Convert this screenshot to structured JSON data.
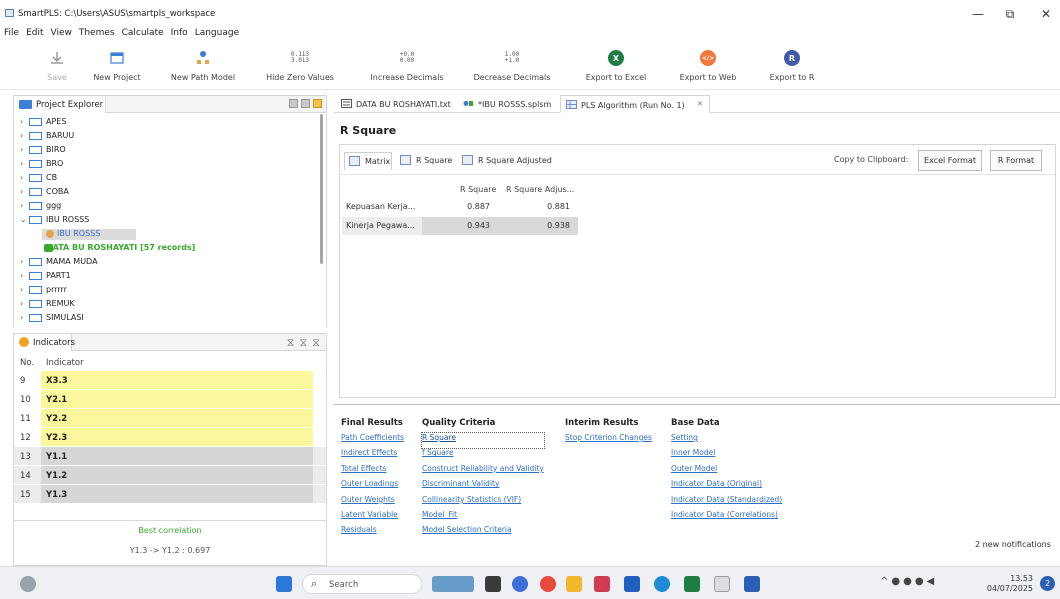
{
  "window": {
    "title": "SmartPLS: C:\\Users\\ASUS\\smartpls_workspace",
    "minimize": "—",
    "restore": "⧉",
    "close": "✕"
  },
  "menu": [
    "File",
    "Edit",
    "View",
    "Themes",
    "Calculate",
    "Info",
    "Language"
  ],
  "toolbar": {
    "save": "Save",
    "new_project": "New Project",
    "new_path_model": "New Path Model",
    "hide_zero_values": "Hide Zero Values",
    "hide_zero_icon": "0.113\n3.013",
    "increase_decimals": "Increase Decimals",
    "increase_icon": "+0.0\n0.00",
    "decrease_decimals": "Decrease Decimals",
    "decrease_icon": "1.00\n+1.0",
    "export_excel": "Export to Excel",
    "export_web": "Export to Web",
    "export_r": "Export to R",
    "excel_glyph": "X",
    "web_glyph": "</>",
    "r_glyph": "R"
  },
  "project_explorer": {
    "title": "Project Explorer",
    "items": [
      {
        "label": "APES"
      },
      {
        "label": "BARUU"
      },
      {
        "label": "BIRO"
      },
      {
        "label": "BRO"
      },
      {
        "label": "CB"
      },
      {
        "label": "COBA"
      },
      {
        "label": "ggg"
      },
      {
        "label": "IBU ROSSS"
      },
      {
        "label": "IBU ROSSS"
      },
      {
        "label": "DATA BU ROSHAYATI [57 records]"
      },
      {
        "label": "MAMA MUDA"
      },
      {
        "label": "PART1"
      },
      {
        "label": "prrrrr"
      },
      {
        "label": "REMUK"
      },
      {
        "label": "SIMULASI"
      }
    ]
  },
  "indicators": {
    "title": "Indicators",
    "col_no": "No.",
    "col_indicator": "Indicator",
    "rows": [
      {
        "no": "9",
        "name": "X3.3"
      },
      {
        "no": "10",
        "name": "Y2.1"
      },
      {
        "no": "11",
        "name": "Y2.2"
      },
      {
        "no": "12",
        "name": "Y2.3"
      },
      {
        "no": "13",
        "name": "Y1.1"
      },
      {
        "no": "14",
        "name": "Y1.2"
      },
      {
        "no": "15",
        "name": "Y1.3"
      }
    ],
    "best_correlation_label": "Best correlation",
    "best_correlation_value": "Y1.3 -> Y1.2 : 0.697"
  },
  "editor_tabs": [
    {
      "label": "DATA BU ROSHAYATI.txt"
    },
    {
      "label": "*IBU ROSSS.splsm"
    },
    {
      "label": "PLS Algorithm (Run No. 1)",
      "close": "✕"
    }
  ],
  "results": {
    "title": "R Square",
    "subtabs": [
      "Matrix",
      "R Square",
      "R Square Adjusted"
    ],
    "copy_to_clipboard": "Copy to Clipboard:",
    "excel_format": "Excel Format",
    "r_format": "R Format",
    "columns": [
      "R Square",
      "R Square Adjus..."
    ],
    "rows": [
      {
        "label": "Kepuasan Kerja...",
        "r2": "0.887",
        "r2adj": "0.881"
      },
      {
        "label": "Kinerja Pegawa...",
        "r2": "0.943",
        "r2adj": "0.938"
      }
    ]
  },
  "nav": {
    "final_results": {
      "title": "Final Results",
      "links": [
        "Path Coefficients",
        "Indirect Effects",
        "Total Effects",
        "Outer Loadings",
        "Outer Weights",
        "Latent Variable",
        "Residuals"
      ]
    },
    "quality_criteria": {
      "title": "Quality Criteria",
      "links": [
        "R Square",
        "f Square",
        "Construct Reliability and Validity",
        "Discriminant Validity",
        "Collinearity Statistics (VIF)",
        "Model_Fit",
        "Model Selection Criteria"
      ]
    },
    "interim_results": {
      "title": "Interim Results",
      "links": [
        "Stop Criterion Changes"
      ]
    },
    "base_data": {
      "title": "Base Data",
      "links": [
        "Setting",
        "Inner Model",
        "Outer Model",
        "Indicator Data (Original)",
        "Indicator Data (Standardized)",
        "Indicator Data (Correlations)"
      ]
    }
  },
  "notification": "2 new notifications",
  "taskbar": {
    "search_placeholder": "Search",
    "time": "13.53",
    "date": "04/07/2025",
    "badge": "2"
  }
}
